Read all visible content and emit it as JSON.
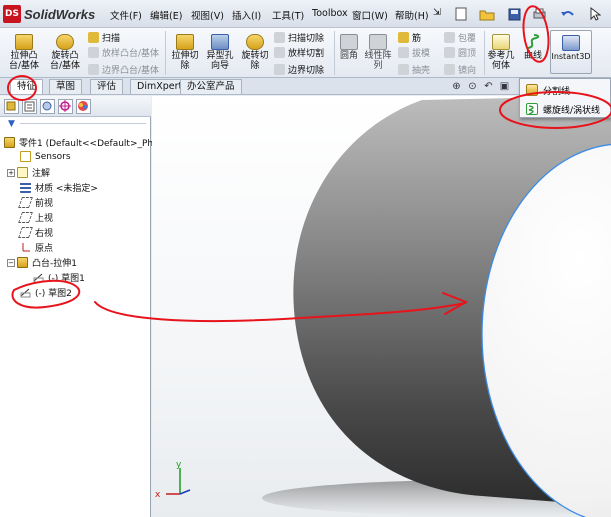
{
  "app": {
    "logo_badge": "DS",
    "name": "SolidWorks"
  },
  "menu": {
    "items": [
      "文件(F)",
      "编辑(E)",
      "视图(V)",
      "插入(I)",
      "工具(T)",
      "Toolbox",
      "窗口(W)",
      "帮助(H)"
    ],
    "pin": "⇲"
  },
  "ribbon": {
    "extrude_boss": "拉伸凸\n台/基体",
    "revolve_boss": "旋转凸\n台/基体",
    "sweep": "扫描",
    "loft": "放样凸台/基体",
    "boundary_boss": "边界凸台/基体",
    "extrude_cut": "拉伸切\n除",
    "hole_wizard": "异型孔\n向导",
    "revolve_cut": "旋转切\n除",
    "swept_cut": "扫描切除",
    "lofted_cut": "放样切割",
    "boundary_cut": "边界切除",
    "fillet": "圆角",
    "linear_pattern": "线性阵\n列",
    "rib": "筋",
    "draft": "拔模",
    "shell": "抽壳",
    "wrap": "包覆",
    "dome": "圆顶",
    "mirror": "镜向",
    "ref_geometry": "参考几\n何体",
    "curves": "曲线",
    "instant3d": "Instant3D"
  },
  "tabs": [
    "特征",
    "草图",
    "评估",
    "DimXpert",
    "办公室产品"
  ],
  "dropdown": {
    "items": [
      "分割线",
      "螺旋线/涡状线"
    ]
  },
  "tree": {
    "part": "零件1 (Default<<Default>_Ph",
    "sensors": "Sensors",
    "annotations": "注解",
    "material": "材质 <未指定>",
    "front": "前视",
    "top": "上视",
    "right": "右视",
    "origin": "原点",
    "boss_extrude": "凸台-拉伸1",
    "sketch1": "(-) 草图1",
    "sketch2": "(-) 草图2"
  },
  "triad": {
    "y": "y",
    "x": "x"
  },
  "colors": {
    "accent": "#2f5fc2",
    "annotation_red": "#e8141c",
    "edge_blue": "#3c8ce6"
  }
}
